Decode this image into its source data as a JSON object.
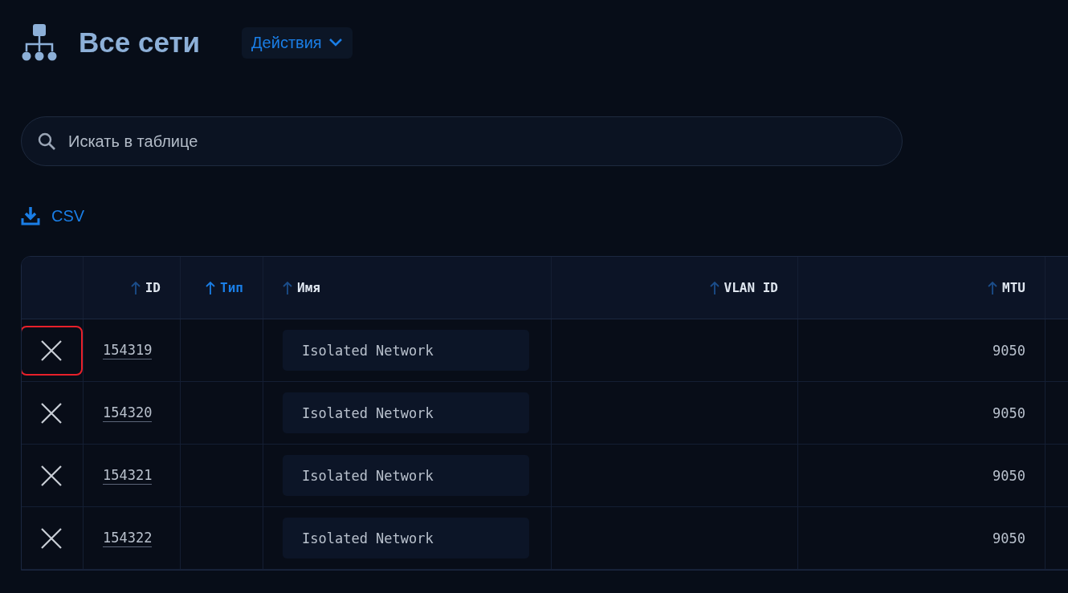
{
  "header": {
    "title": "Все сети",
    "actions_button": "Действия"
  },
  "search": {
    "placeholder": "Искать в таблице"
  },
  "export_link": "CSV",
  "table": {
    "columns": [
      {
        "label": "ID",
        "active": false
      },
      {
        "label": "Тип",
        "active": true
      },
      {
        "label": "Имя",
        "active": false
      },
      {
        "label": "VLAN ID",
        "active": false
      },
      {
        "label": "MTU",
        "active": false
      }
    ],
    "rows": [
      {
        "id": "154319",
        "name": "Isolated Network",
        "mtu": "9050",
        "focused": true
      },
      {
        "id": "154320",
        "name": "Isolated Network",
        "mtu": "9050",
        "focused": false
      },
      {
        "id": "154321",
        "name": "Isolated Network",
        "mtu": "9050",
        "focused": false
      },
      {
        "id": "154322",
        "name": "Isolated Network",
        "mtu": "9050",
        "focused": false
      }
    ]
  }
}
